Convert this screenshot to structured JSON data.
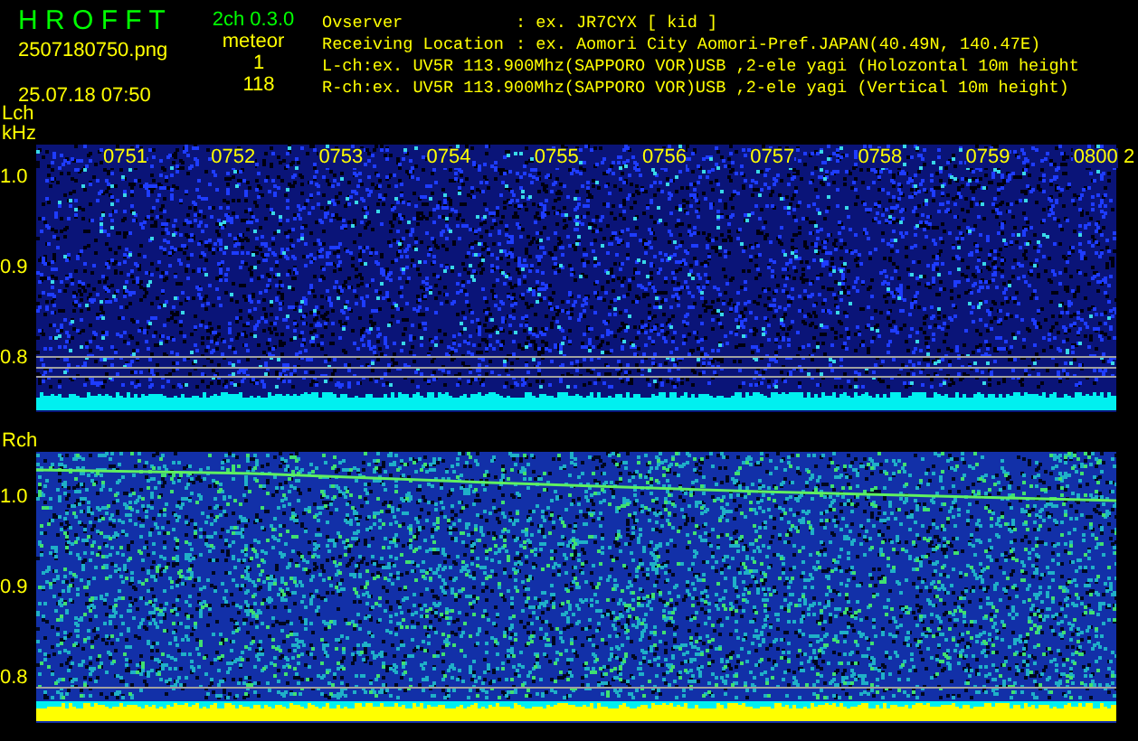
{
  "header": {
    "app_title": "H R O F F T",
    "version": "2ch 0.3.0",
    "filename": "2507180750.png",
    "datetime": "25.07.18 07:50",
    "meteor_label": "meteor",
    "meteor_counts": [
      "1",
      "118"
    ],
    "info": [
      {
        "label": "Ovserver",
        "value": ": ex. JR7CYX [ kid ]"
      },
      {
        "label": "Receiving Location",
        "value": ": ex. Aomori City Aomori-Pref.JAPAN(40.49N, 140.47E)"
      },
      {
        "value": "L-ch:ex. UV5R 113.900Mhz(SAPPORO VOR)USB ,2-ele yagi (Holozontal 10m height"
      },
      {
        "value": "R-ch:ex. UV5R 113.900Mhz(SAPPORO VOR)USB ,2-ele yagi (Vertical 10m height)"
      }
    ]
  },
  "panels": [
    {
      "channel": "Lch",
      "unit": "kHz",
      "kind": "quiet",
      "yticks": [
        "1.0",
        "0.9",
        "0.8"
      ],
      "time_labels": [
        "0751",
        "0752",
        "0753",
        "0754",
        "0755",
        "0756",
        "0757",
        "0758",
        "0759",
        "0800"
      ],
      "edge_label": "2"
    },
    {
      "channel": "Rch",
      "kind": "meteor",
      "yticks": [
        "1.0",
        "0.9",
        "0.8"
      ]
    }
  ]
}
